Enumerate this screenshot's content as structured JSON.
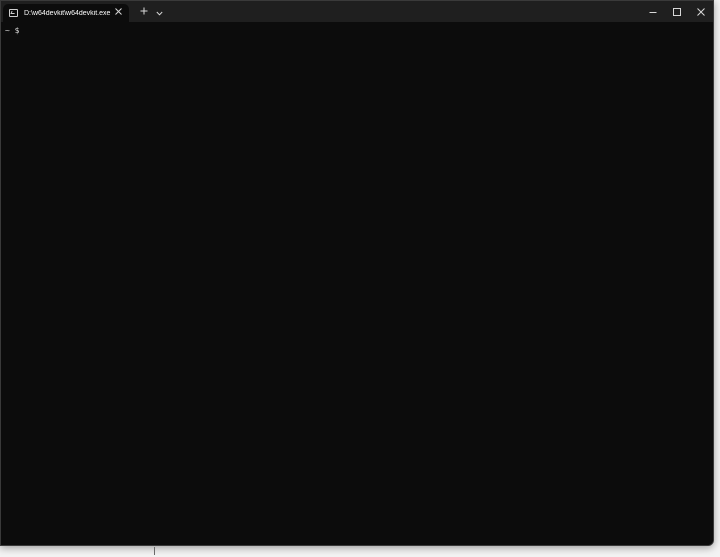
{
  "window": {
    "tab_title": "D:\\w64devkit\\w64devkit.exe",
    "tab_icon": "terminal-icon",
    "tab_close_icon": "close-icon",
    "new_tab_icon": "plus-icon",
    "dropdown_icon": "chevron-down-icon",
    "minimize_icon": "minimize-icon",
    "maximize_icon": "maximize-icon",
    "close_icon": "close-icon"
  },
  "terminal": {
    "prompt": "~ $"
  },
  "colors": {
    "terminal_bg": "#0c0c0c",
    "titlebar_bg": "#1f1f1f",
    "text": "#d8d8d8"
  }
}
